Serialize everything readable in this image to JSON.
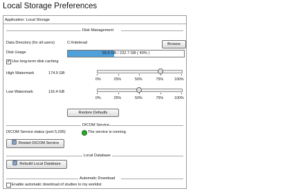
{
  "title": "Local Storage Preferences",
  "app_label": "Application: Local Storage",
  "colors": {
    "usage_fill": "#4f9fd9",
    "status_ok": "#2ea62e"
  },
  "disk": {
    "section": "Disk Management",
    "dir_label": "Data Directory (for all users)",
    "dir_value": "C:\\Intelerad",
    "browse": "Browse",
    "usage_label": "Disk Usage",
    "usage_text": "93.5 GB / 232.7 GB ( 40% )",
    "usage_fraction": 0.4,
    "longterm_label": "Use long-term disk caching",
    "longterm_checked": true,
    "high_label": "High Watermark",
    "high_value": "174.5 GB",
    "high_fraction": 0.75,
    "low_label": "Low Watermark",
    "low_value": "116.4 GB",
    "low_fraction": 0.5,
    "ticks": [
      "0%",
      "25%",
      "50%",
      "75%",
      "100%"
    ],
    "restore": "Restore Defaults"
  },
  "dicom": {
    "section": "DICOM Service",
    "status_label": "DICOM Service status (port 5,035)",
    "status_text": "The service is running.",
    "restart": "Restart DICOM Service"
  },
  "localdb": {
    "section": "Local Database",
    "rebuild": "Rebuild Local Database"
  },
  "auto": {
    "section": "Automatic Download",
    "enable_label": "Enable automatic download of studies to my worklist",
    "enable_checked": false
  }
}
